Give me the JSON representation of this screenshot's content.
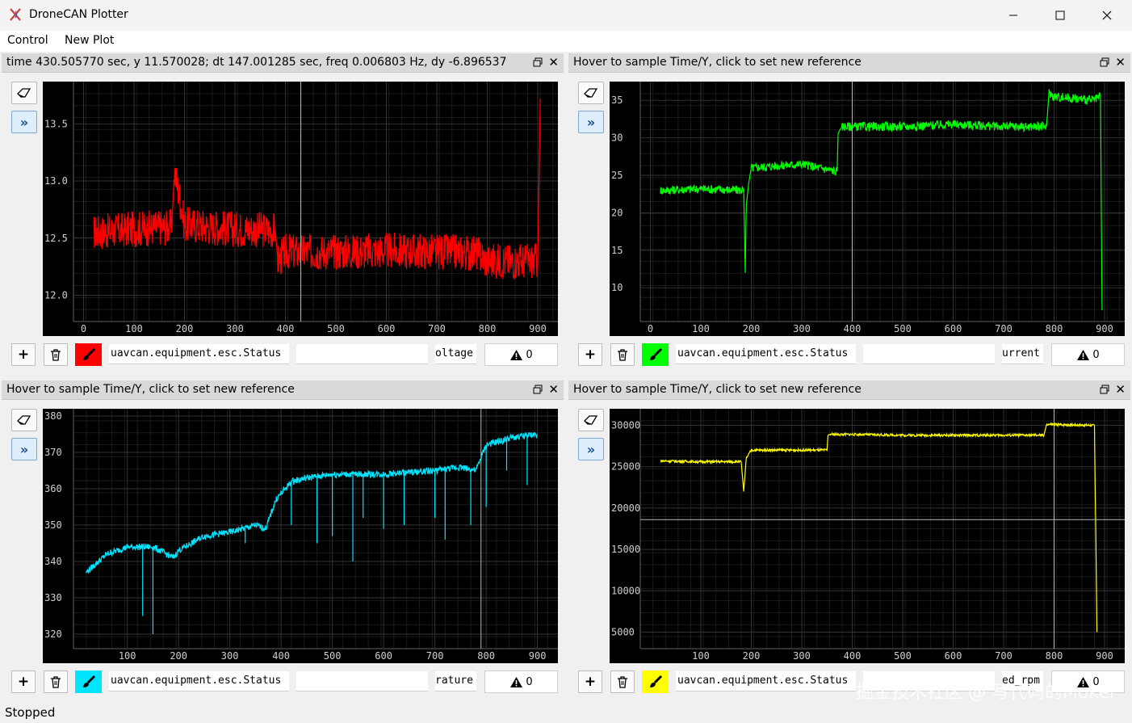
{
  "window": {
    "title": "DroneCAN Plotter"
  },
  "menu": [
    "Control",
    "New Plot"
  ],
  "status": "Stopped",
  "watermark": "掘金技术社区 @ 写代码的Mokel",
  "panels": [
    {
      "header": "time 430.505770 sec,  y 11.570028;    dt 147.001285 sec,  freq 0.006803 Hz,  dy -6.896537",
      "message": "uavcan.equipment.esc.Status",
      "expression": "",
      "field": "oltage",
      "warnings": "0",
      "color": "#ff0000",
      "chart_data": {
        "type": "line",
        "x_ticks": [
          "0",
          "100",
          "200",
          "300",
          "400",
          "500",
          "600",
          "700",
          "800",
          "900"
        ],
        "y_ticks": [
          "12.0",
          "12.5",
          "13.0",
          "13.5"
        ],
        "xlim": [
          -20,
          940
        ],
        "ylim": [
          11.77,
          13.87
        ],
        "cursor_x": 430.5,
        "series": [
          {
            "x": [
              20,
              100,
              175,
              180,
              200,
              250,
              300,
              380,
              385,
              400,
              500,
              600,
              700,
              780,
              800,
              880,
              900,
              905
            ],
            "y": [
              12.55,
              12.58,
              12.6,
              13.1,
              12.62,
              12.6,
              12.58,
              12.57,
              12.3,
              12.38,
              12.38,
              12.39,
              12.38,
              12.37,
              12.3,
              12.3,
              12.3,
              13.72
            ]
          }
        ],
        "noise": 0.16
      }
    },
    {
      "header": "Hover to sample Time/Y, click to set new reference",
      "message": "uavcan.equipment.esc.Status",
      "expression": "",
      "field": "urrent",
      "warnings": "0",
      "color": "#00ff00",
      "chart_data": {
        "type": "line",
        "x_ticks": [
          "0",
          "100",
          "200",
          "300",
          "400",
          "500",
          "600",
          "700",
          "800",
          "900"
        ],
        "y_ticks": [
          "10",
          "15",
          "20",
          "25",
          "30",
          "35"
        ],
        "xlim": [
          -20,
          940
        ],
        "ylim": [
          5.5,
          37.5
        ],
        "cursor_x": 400,
        "series": [
          {
            "x": [
              20,
              100,
              185,
              188,
              190,
              195,
              200,
              300,
              370,
              372,
              375,
              380,
              400,
              500,
              600,
              700,
              785,
              790,
              800,
              880,
              892,
              895
            ],
            "y": [
              23,
              23.2,
              23,
              12,
              21,
              24,
              26,
              26.5,
              25.5,
              30.5,
              31,
              31.5,
              31.5,
              31.5,
              31.8,
              31.5,
              31.5,
              36,
              35.5,
              35,
              35.5,
              7
            ]
          }
        ],
        "noise": 0.6
      }
    },
    {
      "header": "Hover to sample Time/Y, click to set new reference",
      "message": "uavcan.equipment.esc.Status",
      "expression": "",
      "field": "rature",
      "warnings": "0",
      "color": "#00e5ff",
      "chart_data": {
        "type": "line",
        "x_ticks": [
          "100",
          "200",
          "300",
          "400",
          "500",
          "600",
          "700",
          "800",
          "900"
        ],
        "y_ticks": [
          "320",
          "330",
          "340",
          "350",
          "360",
          "370",
          "380"
        ],
        "xlim": [
          -5,
          940
        ],
        "ylim": [
          316,
          382
        ],
        "cursor_x": 790,
        "series": [
          {
            "x": [
              20,
              60,
              100,
              150,
              190,
              200,
              250,
              300,
              350,
              370,
              390,
              420,
              450,
              500,
              600,
              700,
              750,
              780,
              800,
              850,
              900
            ],
            "y": [
              337,
              342,
              344,
              344,
              341,
              343,
              347,
              348,
              350,
              349,
              357,
              362,
              363,
              364,
              364,
              365,
              366,
              365,
              372,
              374,
              375
            ]
          }
        ],
        "noise": 0.9,
        "spikes": [
          [
            130,
            325
          ],
          [
            150,
            320
          ],
          [
            330,
            345
          ],
          [
            420,
            350
          ],
          [
            470,
            345
          ],
          [
            500,
            347
          ],
          [
            540,
            340
          ],
          [
            560,
            352
          ],
          [
            600,
            349
          ],
          [
            640,
            350
          ],
          [
            700,
            352
          ],
          [
            720,
            346
          ],
          [
            770,
            350
          ],
          [
            800,
            355
          ],
          [
            840,
            365
          ],
          [
            880,
            361
          ]
        ]
      }
    },
    {
      "header": "Hover to sample Time/Y, click to set new reference",
      "message": "uavcan.equipment.esc.Status",
      "expression": "",
      "field": "ed_rpm",
      "warnings": "0",
      "color": "#ffff00",
      "chart_data": {
        "type": "line",
        "x_ticks": [
          "100",
          "200",
          "300",
          "400",
          "500",
          "600",
          "700",
          "800",
          "900"
        ],
        "y_ticks": [
          "5000",
          "10000",
          "15000",
          "20000",
          "25000",
          "30000"
        ],
        "xlim": [
          -20,
          940
        ],
        "ylim": [
          3000,
          32000
        ],
        "cursor_x": 800,
        "cursor_y": 18600,
        "series": [
          {
            "x": [
              20,
              100,
              180,
              185,
              190,
              200,
              300,
              350,
              352,
              355,
              400,
              500,
              600,
              700,
              780,
              785,
              800,
              880,
              885
            ],
            "y": [
              25700,
              25600,
              25600,
              22000,
              26000,
              27000,
              27000,
              27000,
              28800,
              28900,
              28900,
              28800,
              28800,
              28800,
              28800,
              30100,
              30100,
              30000,
              5000
            ]
          }
        ],
        "noise": 150
      }
    }
  ]
}
